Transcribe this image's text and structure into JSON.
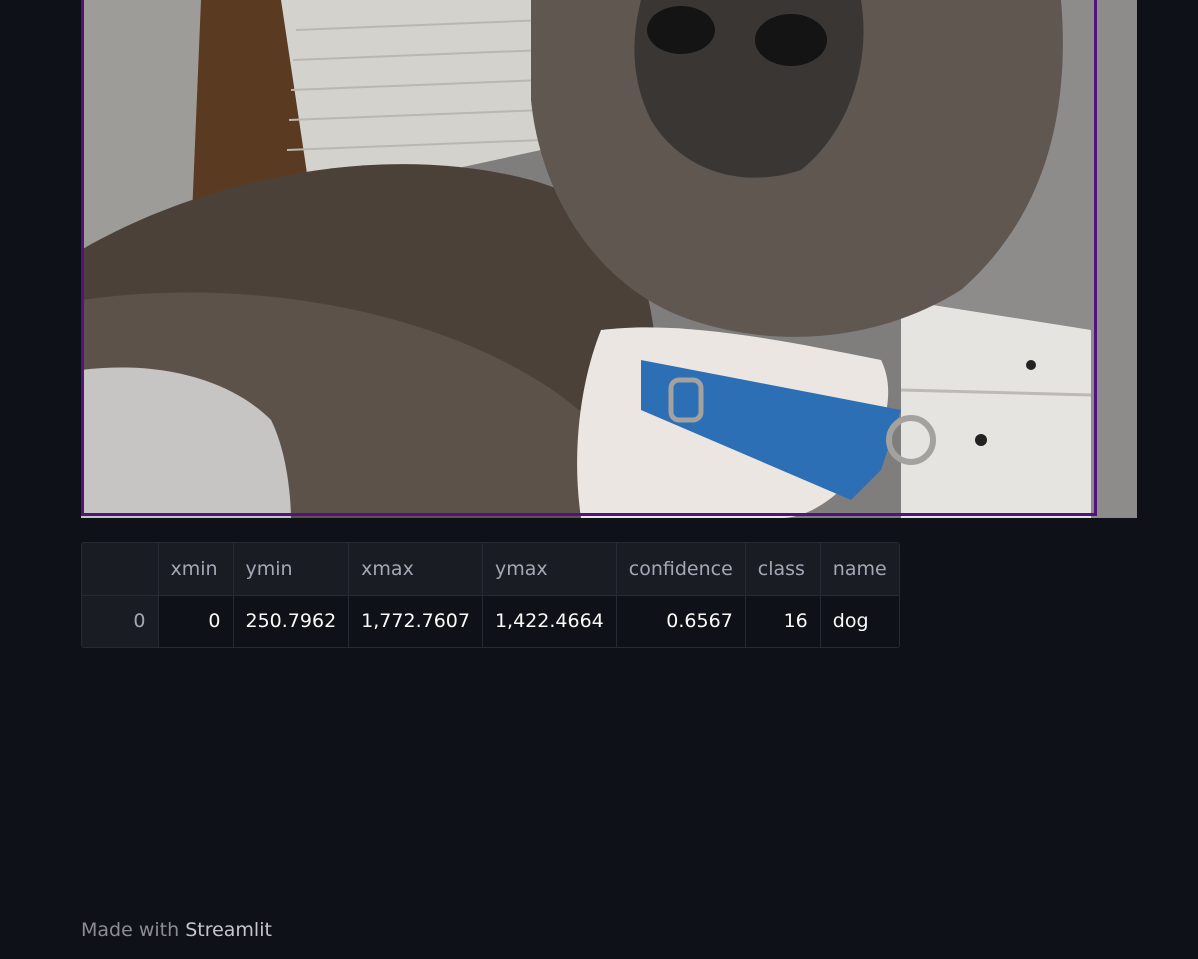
{
  "image": {
    "subject": "dog",
    "box_color": "#52137f"
  },
  "dataframe": {
    "columns": [
      "",
      "xmin",
      "ymin",
      "xmax",
      "ymax",
      "confidence",
      "class",
      "name"
    ],
    "rows": [
      [
        "0",
        "0",
        "250.7962",
        "1,772.7607",
        "1,422.4664",
        "0.6567",
        "16",
        "dog"
      ]
    ]
  },
  "footer": {
    "prefix": "Made with",
    "brand": "Streamlit"
  },
  "colors": {
    "background": "#0e1117",
    "header_bg": "#1a1c24",
    "accent_box": "#52137f"
  }
}
